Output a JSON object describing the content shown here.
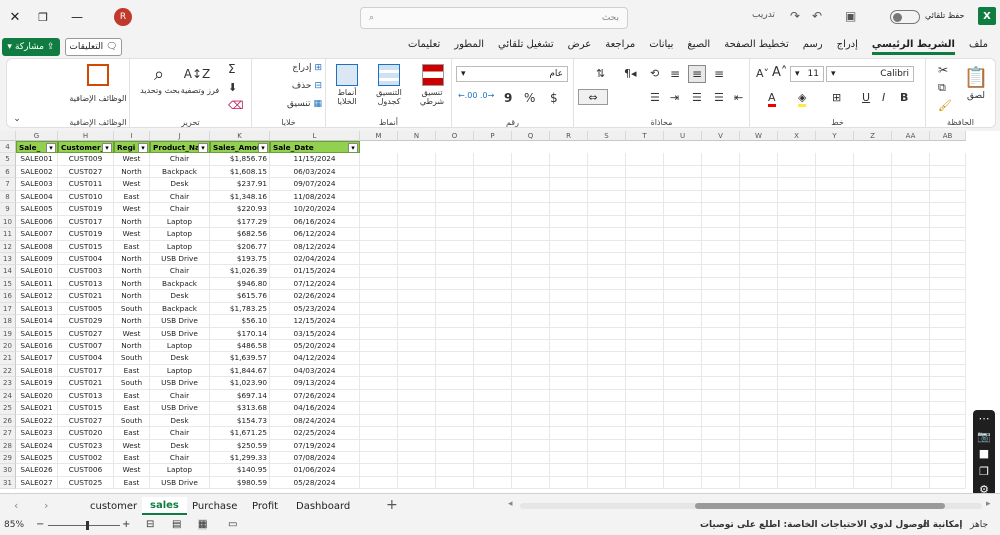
{
  "title": {
    "autosave_label": "حفظ تلقائي",
    "doc_name": "تدريب",
    "search_placeholder": "بحث",
    "avatar_initial": "R"
  },
  "tabs": [
    "ملف",
    "الشريط الرئيسي",
    "إدراج",
    "رسم",
    "تخطيط الصفحة",
    "الصيغ",
    "بيانات",
    "مراجعة",
    "عرض",
    "تشغيل تلقائي",
    "المطور",
    "تعليمات"
  ],
  "share_label": "مشاركة",
  "comments_label": "التعليقات",
  "ribbon": {
    "paste": "لصق",
    "clipboard": "الحافظة",
    "font_name": "Calibri",
    "font_size": "11",
    "font": "خط",
    "alignment": "محاذاة",
    "number_format": "عام",
    "number": "رقم",
    "cond_format": "تنسيق شرطي",
    "format_table": "التنسيق كجدول",
    "cell_styles": "أنماط الخلايا",
    "styles": "أنماط",
    "insert": "إدراج",
    "delete": "حذف",
    "format": "تنسيق",
    "cells": "خلايا",
    "sort_filter": "فرز وتصفية",
    "find_select": "بحث وتحديد",
    "editing": "تحرير",
    "addins": "الوظائف الإضافية",
    "addins_group": "الوظائف الإضافية"
  },
  "columns": [
    "G",
    "H",
    "I",
    "J",
    "K",
    "L",
    "M",
    "N",
    "O",
    "P",
    "Q",
    "R",
    "S",
    "T",
    "U",
    "V",
    "W",
    "X",
    "Y",
    "Z",
    "AA",
    "AB"
  ],
  "row_numbers": [
    4,
    5,
    6,
    7,
    8,
    9,
    10,
    11,
    12,
    13,
    14,
    15,
    16,
    17,
    18,
    19,
    20,
    21,
    22,
    23,
    24,
    25,
    26,
    27,
    28,
    29,
    30,
    31
  ],
  "headers": [
    "Sale_",
    "Customer_",
    "Regi",
    "Product_Nar",
    "Sales_Amou",
    "Sale_Date"
  ],
  "rows": [
    [
      "SALE001",
      "CUST009",
      "West",
      "Chair",
      "$1,856.76",
      "11/15/2024"
    ],
    [
      "SALE002",
      "CUST027",
      "North",
      "Backpack",
      "$1,608.15",
      "06/03/2024"
    ],
    [
      "SALE003",
      "CUST011",
      "West",
      "Desk",
      "$237.91",
      "09/07/2024"
    ],
    [
      "SALE004",
      "CUST010",
      "East",
      "Chair",
      "$1,348.16",
      "11/08/2024"
    ],
    [
      "SALE005",
      "CUST019",
      "West",
      "Chair",
      "$220.93",
      "10/20/2024"
    ],
    [
      "SALE006",
      "CUST017",
      "North",
      "Laptop",
      "$177.29",
      "06/16/2024"
    ],
    [
      "SALE007",
      "CUST019",
      "West",
      "Laptop",
      "$682.56",
      "06/12/2024"
    ],
    [
      "SALE008",
      "CUST015",
      "East",
      "Laptop",
      "$206.77",
      "08/12/2024"
    ],
    [
      "SALE009",
      "CUST004",
      "North",
      "USB Drive",
      "$193.75",
      "02/04/2024"
    ],
    [
      "SALE010",
      "CUST003",
      "North",
      "Chair",
      "$1,026.39",
      "01/15/2024"
    ],
    [
      "SALE011",
      "CUST013",
      "North",
      "Backpack",
      "$946.80",
      "07/12/2024"
    ],
    [
      "SALE012",
      "CUST021",
      "North",
      "Desk",
      "$615.76",
      "02/26/2024"
    ],
    [
      "SALE013",
      "CUST005",
      "South",
      "Backpack",
      "$1,783.25",
      "05/23/2024"
    ],
    [
      "SALE014",
      "CUST029",
      "North",
      "USB Drive",
      "$56.10",
      "12/15/2024"
    ],
    [
      "SALE015",
      "CUST027",
      "West",
      "USB Drive",
      "$170.14",
      "03/15/2024"
    ],
    [
      "SALE016",
      "CUST007",
      "North",
      "Laptop",
      "$486.58",
      "05/20/2024"
    ],
    [
      "SALE017",
      "CUST004",
      "South",
      "Desk",
      "$1,639.57",
      "04/12/2024"
    ],
    [
      "SALE018",
      "CUST017",
      "East",
      "Laptop",
      "$1,844.67",
      "04/03/2024"
    ],
    [
      "SALE019",
      "CUST021",
      "South",
      "USB Drive",
      "$1,023.90",
      "09/13/2024"
    ],
    [
      "SALE020",
      "CUST013",
      "East",
      "Chair",
      "$697.14",
      "07/26/2024"
    ],
    [
      "SALE021",
      "CUST015",
      "East",
      "USB Drive",
      "$313.68",
      "04/16/2024"
    ],
    [
      "SALE022",
      "CUST027",
      "South",
      "Desk",
      "$154.73",
      "08/24/2024"
    ],
    [
      "SALE023",
      "CUST020",
      "East",
      "Chair",
      "$1,671.25",
      "02/25/2024"
    ],
    [
      "SALE024",
      "CUST023",
      "West",
      "Desk",
      "$250.59",
      "07/19/2024"
    ],
    [
      "SALE025",
      "CUST002",
      "East",
      "Chair",
      "$1,299.33",
      "07/08/2024"
    ],
    [
      "SALE026",
      "CUST006",
      "West",
      "Laptop",
      "$140.95",
      "01/06/2024"
    ],
    [
      "SALE027",
      "CUST025",
      "East",
      "USB Drive",
      "$980.59",
      "05/28/2024"
    ]
  ],
  "sheets": [
    "customer",
    "sales",
    "Purchase",
    "Profit",
    "Dashboard"
  ],
  "active_sheet": "sales",
  "status": {
    "ready": "جاهز",
    "accessibility": "إمكانية الوصول لذوي الاحتياجات الخاصة: اطلع على توصيات",
    "zoom": "85%"
  },
  "colors": {
    "accent": "#107c41",
    "header_fill": "#92d050"
  }
}
